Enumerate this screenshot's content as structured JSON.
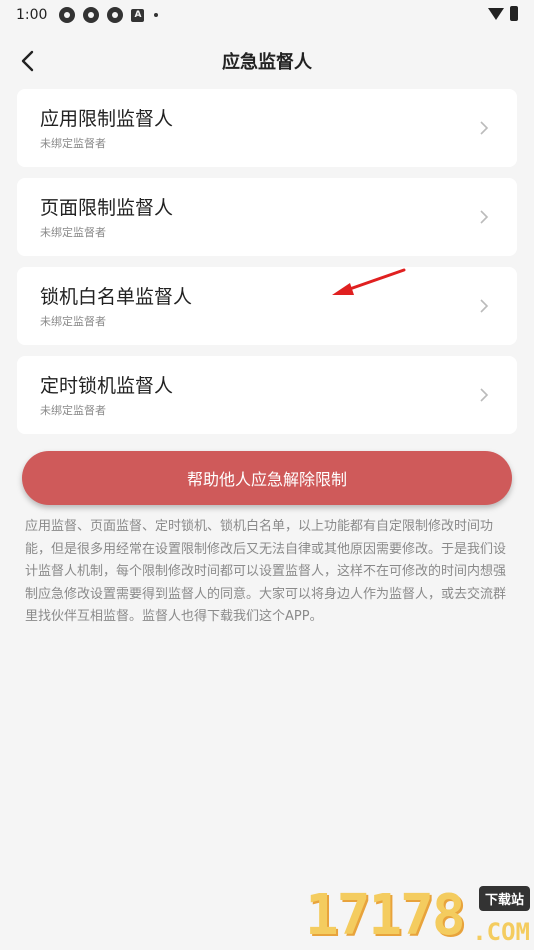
{
  "status_bar": {
    "time": "1:00",
    "badge": "A"
  },
  "header": {
    "title": "应急监督人"
  },
  "cards": [
    {
      "title": "应用限制监督人",
      "subtitle": "未绑定监督者"
    },
    {
      "title": "页面限制监督人",
      "subtitle": "未绑定监督者"
    },
    {
      "title": "锁机白名单监督人",
      "subtitle": "未绑定监督者"
    },
    {
      "title": "定时锁机监督人",
      "subtitle": "未绑定监督者"
    }
  ],
  "help_button": {
    "label": "帮助他人应急解除限制"
  },
  "description": "应用监督、页面监督、定时锁机、锁机白名单，以上功能都有自定限制修改时间功能，但是很多用经常在设置限制修改后又无法自律或其他原因需要修改。于是我们设计监督人机制，每个限制修改时间都可以设置监督人，这样不在可修改的时间内想强制应急修改设置需要得到监督人的同意。大家可以将身边人作为监督人，或去交流群里找伙伴互相监督。监督人也得下载我们这个APP。",
  "watermark": {
    "number": "17178",
    "tag": "下载站",
    "suffix": ".COM"
  },
  "colors": {
    "accent": "#cf5a5a",
    "background": "#f5f5f5",
    "annotation": "#e02020"
  }
}
